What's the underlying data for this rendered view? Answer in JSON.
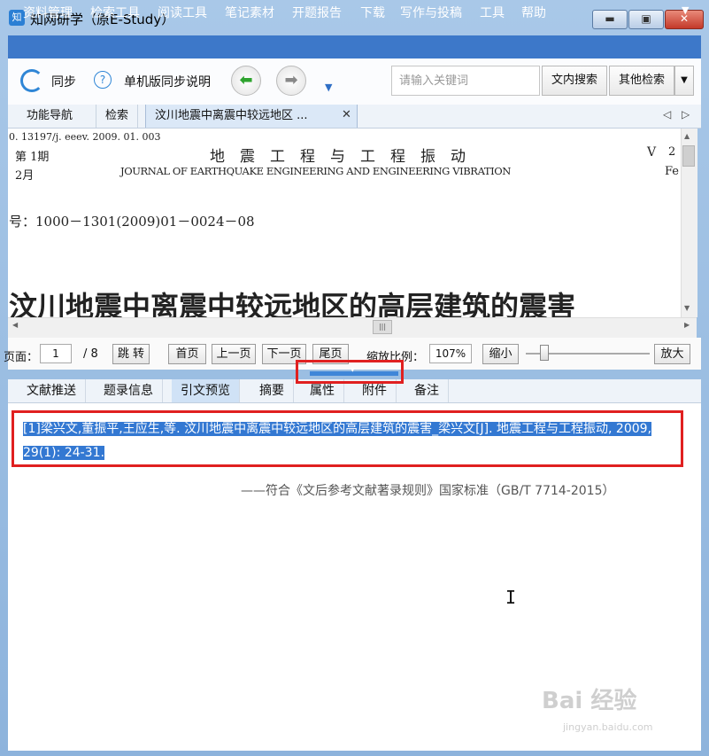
{
  "window": {
    "title": "知网研学（原E-Study）",
    "app_icon": "cnki-logo-icon",
    "min_glyph": "▬",
    "max_glyph": "▣",
    "close_glyph": "✕"
  },
  "menubar": {
    "items": [
      "资料管理",
      "检索工具",
      "阅读工具",
      "笔记素材",
      "开题报告",
      "下载",
      "写作与投稿",
      "工具",
      "帮助"
    ],
    "overflow": "▼"
  },
  "toolbar": {
    "sync_label": "同步",
    "help_glyph": "?",
    "help_label": "单机版同步说明",
    "back_glyph": "⬅",
    "forward_glyph": "➡",
    "dropdown_glyph": "▼",
    "search_placeholder": "请输入关键词",
    "inner_search_label": "文内搜索",
    "other_search_label": "其他检索",
    "other_search_drop": "▼"
  },
  "tabs": {
    "nav_label": "功能导航",
    "search_label": "检索",
    "doc_label": "汶川地震中离震中较远地区 ...",
    "close_glyph": "✕",
    "prev_glyph": "◁",
    "next_glyph": "▷"
  },
  "document": {
    "doi_line": "0. 13197∕j. eeev. 2009. 01. 003",
    "issue": "第 1期",
    "month": "2月",
    "journal_cn": "地　震　工　程　与　工　程　振　动",
    "journal_en": "JOURNAL OF EARTHQUAKE ENGINEERING AND ENGINEERING VIBRATION",
    "right_top": "V",
    "right_num": "2",
    "right_fe": "Fe",
    "article_no": "号：1000－1301(2009)01－0024－08",
    "title": "汶川地震中离震中较远地区的高层建筑的震害"
  },
  "scroll": {
    "up": "▲",
    "down": "▼",
    "left": "◀",
    "right": "▶",
    "grip": "|||"
  },
  "pager": {
    "page_label": "页面：",
    "current_page": "1",
    "total_pages": "/ 8",
    "jump_label": "跳 转",
    "first_label": "首页",
    "prev_label": "上一页",
    "next_label": "下一页",
    "last_label": "尾页",
    "zoom_label": "缩放比例：",
    "zoom_value": "107%",
    "zoom_out_label": "缩小",
    "zoom_in_label": "放大",
    "zoom_level_fraction": 0.15
  },
  "splitter": {
    "arrow": "▼"
  },
  "bottom_tabs": [
    "文献推送",
    "题录信息",
    "引文预览",
    "摘要",
    "属性",
    "附件",
    "备注"
  ],
  "citation": {
    "text": "[1]梁兴文,董振平,王应生,等. 汶川地震中离震中较远地区的高层建筑的震害_梁兴文[J]. 地震工程与工程振动, 2009, 29(1): 24-31.",
    "standard_note": "——符合《文后参考文献著录规则》国家标准（GB/T 7714-2015）"
  },
  "cursor_glyph": "I",
  "watermark": {
    "text": "Bai 经验",
    "url": "jingyan.baidu.com"
  },
  "colors": {
    "menubar": "#3d78c9",
    "highlight": "#3378d2",
    "annotation": "#e02020"
  }
}
